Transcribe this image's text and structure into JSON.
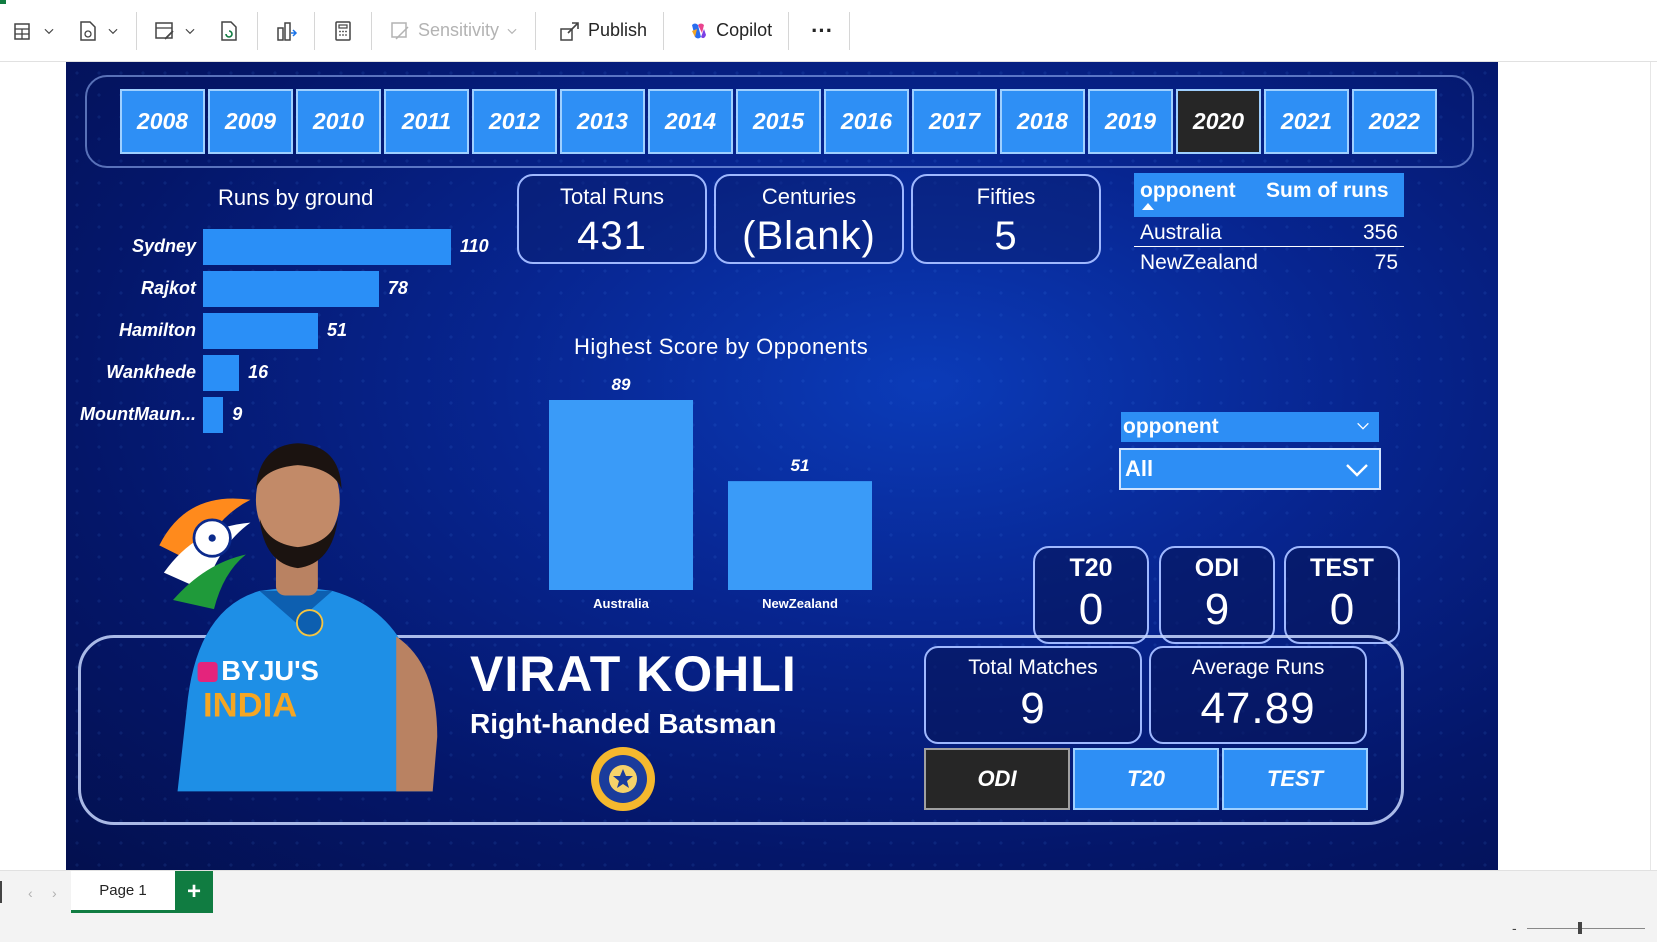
{
  "toolbar": {
    "sensitivity_label": "Sensitivity",
    "publish_label": "Publish",
    "copilot_label": "Copilot",
    "more_label": "···"
  },
  "years": [
    "2008",
    "2009",
    "2010",
    "2011",
    "2012",
    "2013",
    "2014",
    "2015",
    "2016",
    "2017",
    "2018",
    "2019",
    "2020",
    "2021",
    "2022"
  ],
  "selected_year": "2020",
  "runs_by_ground": {
    "title": "Runs by ground",
    "grounds": [
      "Sydney",
      "Rajkot",
      "Hamilton",
      "Wankhede",
      "MountMaun..."
    ],
    "values": [
      110,
      78,
      51,
      16,
      9
    ],
    "max": 110
  },
  "kpis": {
    "total_runs": {
      "title": "Total Runs",
      "value": "431"
    },
    "centuries": {
      "title": "Centuries",
      "value": "(Blank)"
    },
    "fifties": {
      "title": "Fifties",
      "value": "5"
    }
  },
  "opponent_table": {
    "col1": "opponent",
    "col2": "Sum of runs",
    "rows": [
      {
        "opponent": "Australia",
        "runs": "356"
      },
      {
        "opponent": "NewZealand",
        "runs": "75"
      }
    ]
  },
  "chart_data": {
    "type": "bar",
    "title": "Highest Score by Opponents",
    "categories": [
      "Australia",
      "NewZealand"
    ],
    "values": [
      89,
      51
    ],
    "xlabel": "",
    "ylabel": "",
    "ylim": [
      0,
      89
    ],
    "color": "#3a9bf8"
  },
  "opponent_slicer": {
    "label": "opponent",
    "value": "All"
  },
  "format_counts": {
    "t20": {
      "title": "T20",
      "value": "0"
    },
    "odi": {
      "title": "ODI",
      "value": "9"
    },
    "test": {
      "title": "TEST",
      "value": "0"
    }
  },
  "player": {
    "name": "VIRAT KOHLI",
    "role": "Right-handed Batsman",
    "jersey_sponsor": "BYJU'S",
    "jersey_text": "INDIA"
  },
  "summary": {
    "total_matches": {
      "title": "Total Matches",
      "value": "9"
    },
    "average_runs": {
      "title": "Average Runs",
      "value": "47.89"
    }
  },
  "format_buttons": [
    {
      "label": "ODI",
      "selected": true
    },
    {
      "label": "T20",
      "selected": false
    },
    {
      "label": "TEST",
      "selected": false
    }
  ],
  "pages": {
    "tab_label": "Page 1",
    "add_label": "+"
  },
  "colors": {
    "accent_blue": "#2e8ff5",
    "selected_dark": "#262626",
    "report_bg": "#041669",
    "excel_green": "#107c41"
  }
}
